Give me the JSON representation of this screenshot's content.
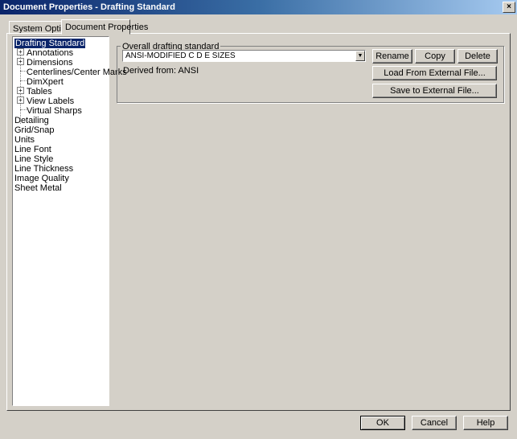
{
  "window": {
    "title": "Document Properties - Drafting Standard",
    "close_glyph": "×"
  },
  "tabs": [
    {
      "label": "System Options",
      "active": false
    },
    {
      "label": "Document Properties",
      "active": true
    }
  ],
  "tree": {
    "items": [
      {
        "label": "Drafting Standard",
        "selected": true
      },
      {
        "label": "Annotations",
        "expander": "+"
      },
      {
        "label": "Dimensions",
        "expander": "+"
      },
      {
        "label": "Centerlines/Center Marks"
      },
      {
        "label": "DimXpert"
      },
      {
        "label": "Tables",
        "expander": "+"
      },
      {
        "label": "View Labels",
        "expander": "+"
      },
      {
        "label": "Virtual Sharps"
      },
      {
        "label": "Detailing"
      },
      {
        "label": "Grid/Snap"
      },
      {
        "label": "Units"
      },
      {
        "label": "Line Font"
      },
      {
        "label": "Line Style"
      },
      {
        "label": "Line Thickness"
      },
      {
        "label": "Image Quality"
      },
      {
        "label": "Sheet Metal"
      }
    ]
  },
  "standard": {
    "group_label": "Overall drafting standard",
    "selected_value": "ANSI-MODIFIED C D E SIZES",
    "derived_from": "Derived from: ANSI",
    "dropdown_glyph": "▼"
  },
  "buttons": {
    "rename": "Rename",
    "copy": "Copy",
    "delete": "Delete",
    "load": "Load From External File...",
    "save": "Save to External File..."
  },
  "footer": {
    "ok": "OK",
    "cancel": "Cancel",
    "help": "Help"
  }
}
